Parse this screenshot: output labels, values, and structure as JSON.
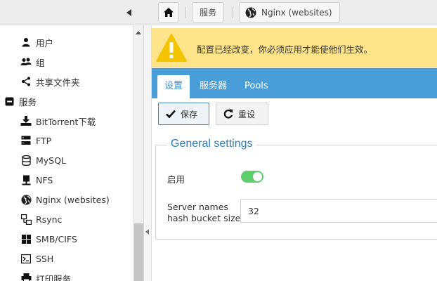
{
  "breadcrumbs": {
    "home_icon": "home-icon",
    "services_label": "服务",
    "nginx_label": "Nginx (websites)",
    "nginx_icon": "globe-icon"
  },
  "sidebar": {
    "items": [
      {
        "label": "用户",
        "icon": "user-icon"
      },
      {
        "label": "组",
        "icon": "users-icon"
      },
      {
        "label": "共享文件夹",
        "icon": "share-icon"
      },
      {
        "label": "服务",
        "icon": "minus-square-icon",
        "group": true,
        "expanded": true
      },
      {
        "label": "BitTorrent下载",
        "icon": "download-icon"
      },
      {
        "label": "FTP",
        "icon": "server-icon"
      },
      {
        "label": "MySQL",
        "icon": "database-icon"
      },
      {
        "label": "NFS",
        "icon": "nfs-icon"
      },
      {
        "label": "Nginx (websites)",
        "icon": "globe-icon"
      },
      {
        "label": "Rsync",
        "icon": "rsync-icon"
      },
      {
        "label": "SMB/CIFS",
        "icon": "windows-icon"
      },
      {
        "label": "SSH",
        "icon": "terminal-icon"
      },
      {
        "label": "打印服务",
        "icon": "printer-icon"
      }
    ]
  },
  "alert": {
    "icon": "warning-icon",
    "text": "配置已经改变，你必须应用才能使他们生效。",
    "color": "#fde48a"
  },
  "tabs": [
    {
      "label": "设置",
      "active": true
    },
    {
      "label": "服务器",
      "active": false
    },
    {
      "label": "Pools",
      "active": false
    }
  ],
  "toolbar": {
    "save_label": "保存",
    "reset_label": "重设"
  },
  "form": {
    "legend": "General settings",
    "enable_label": "启用",
    "enable_value": true,
    "hash_label": "Server names hash bucket size",
    "hash_value": "32"
  },
  "colors": {
    "accent": "#4a9ed8",
    "toggle_on": "#5ccf6c",
    "legend": "#2f7cb8"
  }
}
